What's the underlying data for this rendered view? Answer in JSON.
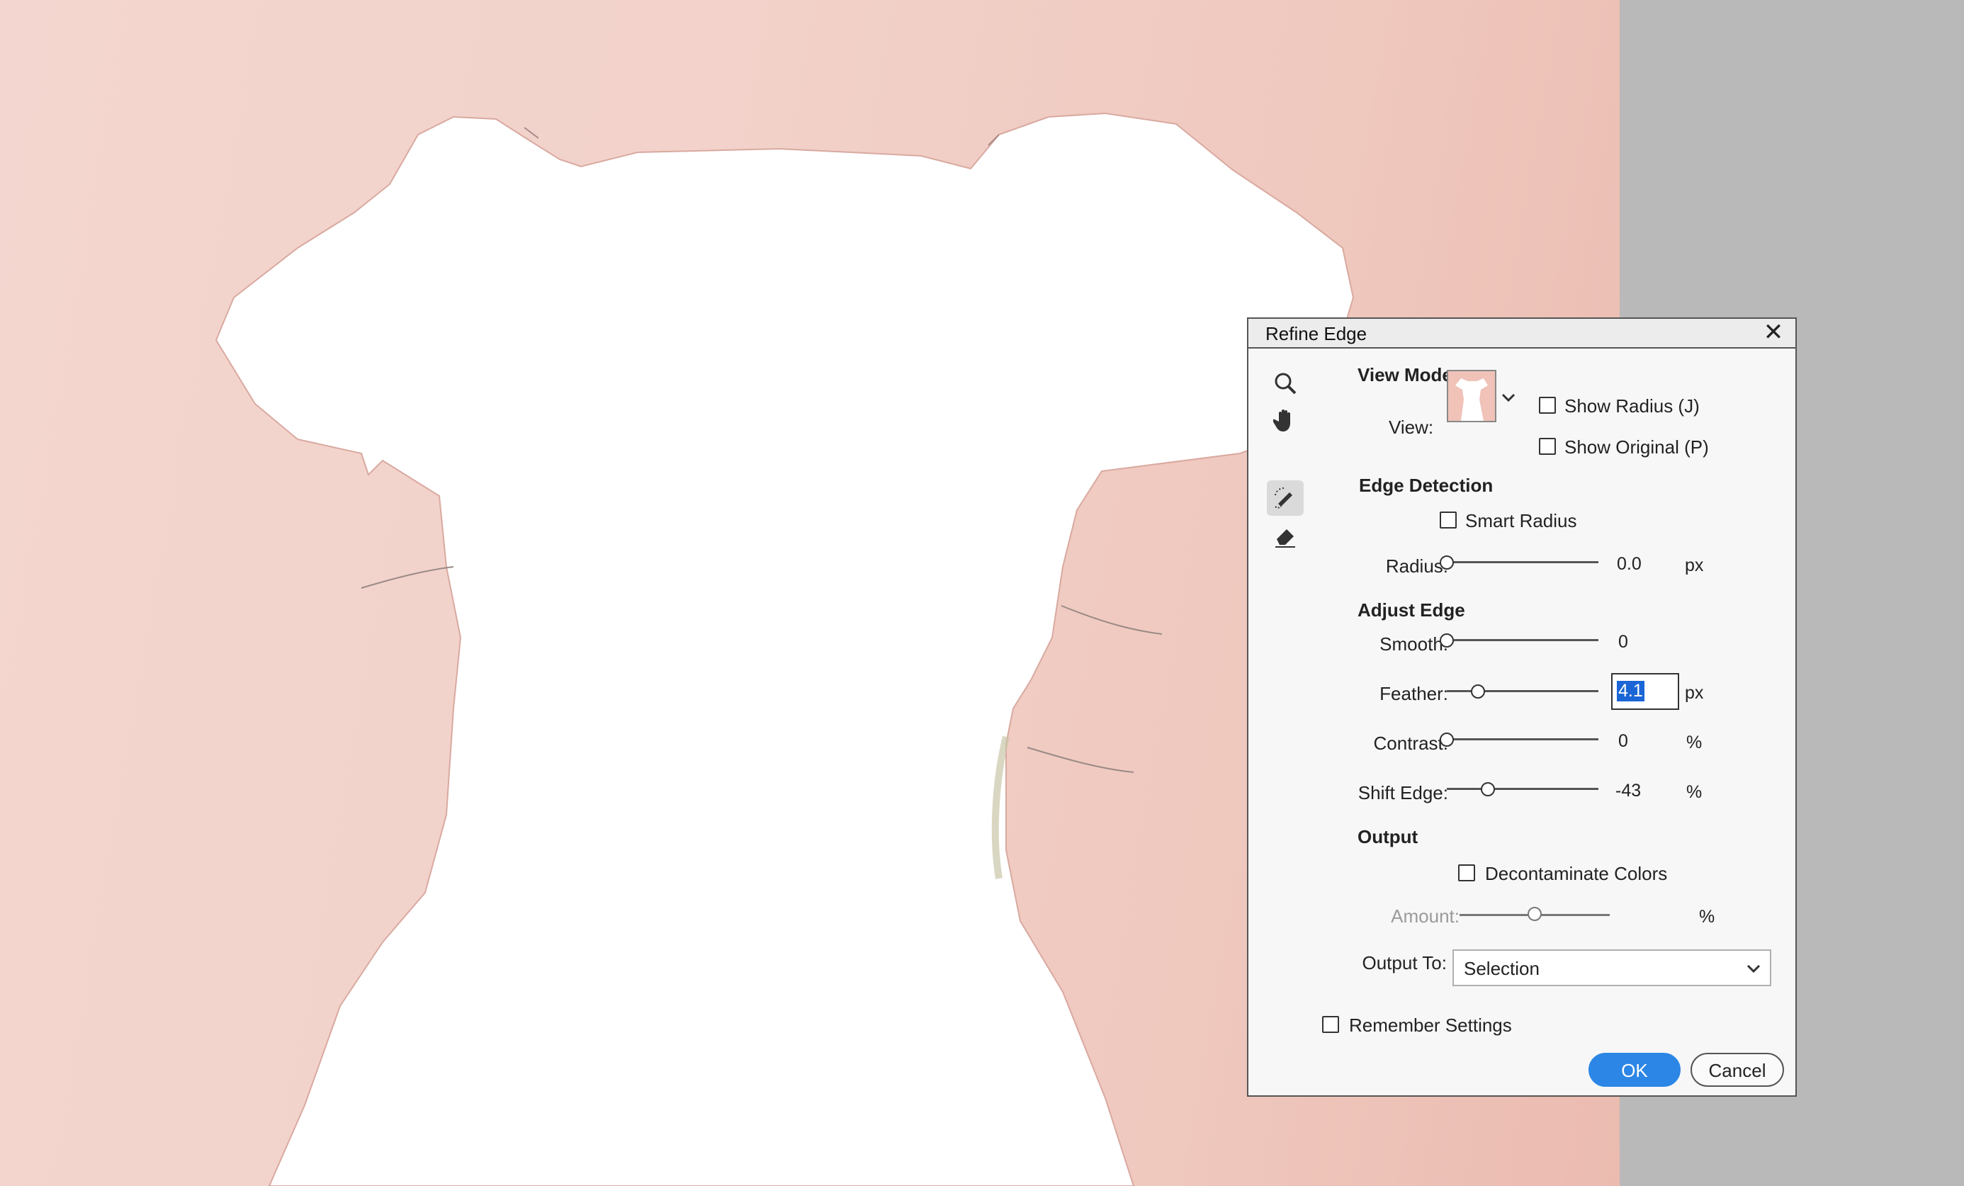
{
  "dialog": {
    "title": "Refine Edge",
    "view_mode": {
      "heading": "View Mode",
      "view_label": "View:",
      "show_radius": "Show Radius (J)",
      "show_original": "Show Original (P)",
      "show_radius_checked": false,
      "show_original_checked": false
    },
    "edge_detection": {
      "heading": "Edge Detection",
      "smart_radius": "Smart Radius",
      "smart_radius_checked": false,
      "radius_label": "Radius:",
      "radius_value": "0.0",
      "radius_unit": "px"
    },
    "adjust_edge": {
      "heading": "Adjust Edge",
      "smooth_label": "Smooth:",
      "smooth_value": "0",
      "feather_label": "Feather:",
      "feather_value": "4.1",
      "feather_unit": "px",
      "contrast_label": "Contrast:",
      "contrast_value": "0",
      "contrast_unit": "%",
      "shift_edge_label": "Shift Edge:",
      "shift_edge_value": "-43",
      "shift_edge_unit": "%"
    },
    "output": {
      "heading": "Output",
      "decontaminate": "Decontaminate Colors",
      "decontaminate_checked": false,
      "amount_label": "Amount:",
      "amount_unit": "%",
      "output_to_label": "Output To:",
      "output_to_value": "Selection"
    },
    "remember_settings": "Remember Settings",
    "remember_checked": false,
    "ok_label": "OK",
    "cancel_label": "Cancel"
  },
  "tools": [
    "zoom-icon",
    "hand-icon",
    "refine-radius-brush-icon",
    "erase-refinements-icon"
  ],
  "colors": {
    "background": "#f2d2ca",
    "gray_area": "#b9b9b9",
    "ok_button": "#2c86e6",
    "selected_text": "#1a66d6"
  }
}
